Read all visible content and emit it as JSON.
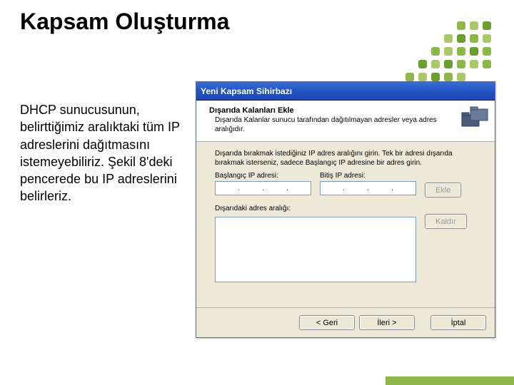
{
  "slide": {
    "title": "Kapsam Oluşturma",
    "body": "DHCP sunucusunun, belirttiğimiz aralıktaki tüm IP adreslerini dağıtmasını istemeyebiliriz. Şekil 8'deki pencerede bu IP adreslerini belirleriz."
  },
  "wizard": {
    "title": "Yeni Kapsam Sihirbazı",
    "header_title": "Dışarıda Kalanları Ekle",
    "header_desc": "Dışarıda Kalanlar sunucu tarafından dağıtılmayan adresler veya adres aralığıdır.",
    "instr": "Dışarıda bırakmak istediğiniz IP adres aralığını girin. Tek bir adresi dışarıda bırakmak isterseniz, sadece Başlangıç IP adresine bir adres girin.",
    "start_label": "Başlangıç IP adresi:",
    "end_label": "Bitiş IP adresi:",
    "add_label": "Ekle",
    "range_label": "Dışarıdaki adres aralığı:",
    "remove_label": "Kaldır",
    "back_label": "< Geri",
    "next_label": "İleri >",
    "cancel_label": "İptal",
    "ip_sep": "."
  }
}
